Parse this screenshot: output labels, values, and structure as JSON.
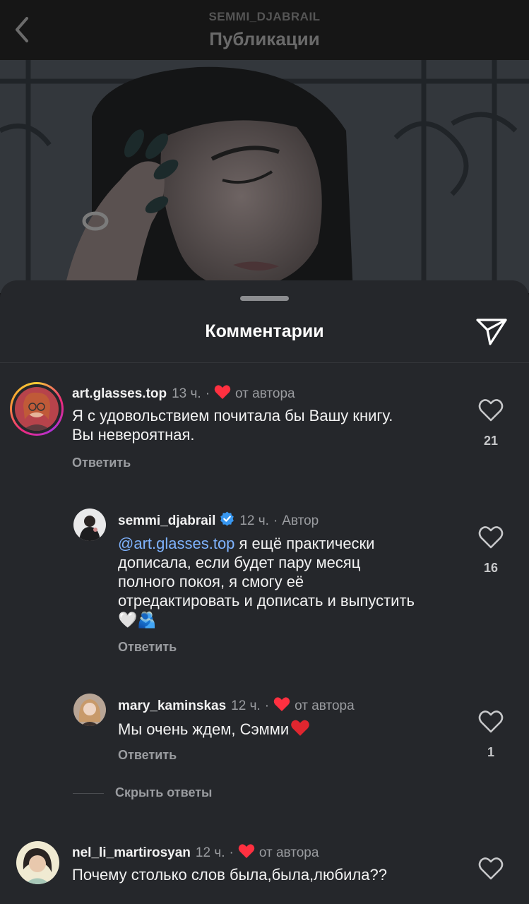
{
  "header": {
    "account": "SEMMI_DJABRAIL",
    "title": "Публикации",
    "back_icon": "chevron-left-icon"
  },
  "sheet": {
    "title": "Комментарии",
    "share_icon": "paper-plane-icon"
  },
  "comments": [
    {
      "username": "art.glasses.top",
      "time": "13 ч.",
      "separator": "·",
      "badge": "от автора",
      "text_lines": [
        "Я с удовольствием почитала бы Вашу книгу.",
        "Вы невероятная."
      ],
      "reply_label": "Ответить",
      "likes": "21"
    },
    {
      "username": "semmi_djabrail",
      "verified": true,
      "time": "12 ч.",
      "separator": "·",
      "badge": "Автор",
      "mention": "@art.glasses.top",
      "text_lines": [
        " я ещё практически",
        "дописала, если будет пару месяц",
        "полного покоя, я смогу её",
        "отредактировать и дописать и выпустить"
      ],
      "emoji_line": "🤍🫂",
      "reply_label": "Ответить",
      "likes": "16"
    },
    {
      "username": "mary_kaminskas",
      "time": "12 ч.",
      "separator": "·",
      "badge": "от автора",
      "text": "Мы очень ждем, Сэмми",
      "reply_label": "Ответить",
      "likes": "1"
    },
    {
      "username": "nel_li_martirosyan",
      "time": "12 ч.",
      "separator": "·",
      "badge": "от автора",
      "text": "Почему столько слов была,была,любила??"
    }
  ],
  "hide_replies_label": "Скрыть ответы",
  "colors": {
    "sheet_bg": "#25272b",
    "mention": "#7fb3ff",
    "heart_red": "#ff3040",
    "verified_blue": "#3897f0"
  }
}
